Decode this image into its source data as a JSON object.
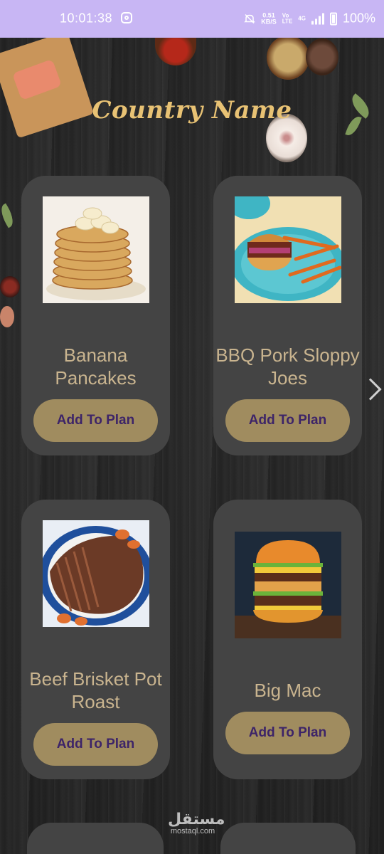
{
  "status_bar": {
    "time": "10:01:38",
    "net_speed_top": "0.51",
    "net_speed_bottom": "KB/S",
    "volte_top": "Vo",
    "volte_bottom": "LTE",
    "network": "4G",
    "battery": "100%"
  },
  "header": {
    "title": "Country Name"
  },
  "meals": [
    {
      "name": "Banana Pancakes",
      "button_label": "Add To Plan",
      "image_icon": "pancakes"
    },
    {
      "name": "BBQ Pork Sloppy Joes",
      "button_label": "Add To Plan",
      "image_icon": "sloppy-joe-burger"
    },
    {
      "name": "Beef Brisket Pot Roast",
      "button_label": "Add To Plan",
      "image_icon": "brisket"
    },
    {
      "name": "Big Mac",
      "button_label": "Add To Plan",
      "image_icon": "burger"
    }
  ],
  "watermark": {
    "arabic": "مستقل",
    "latin": "mostaql.com"
  },
  "colors": {
    "status_bar": "#c8b6f4",
    "title": "#e8c274",
    "card": "#444444",
    "card_text": "#c9b48f",
    "button": "#a08c5f",
    "button_text": "#3d2468"
  }
}
